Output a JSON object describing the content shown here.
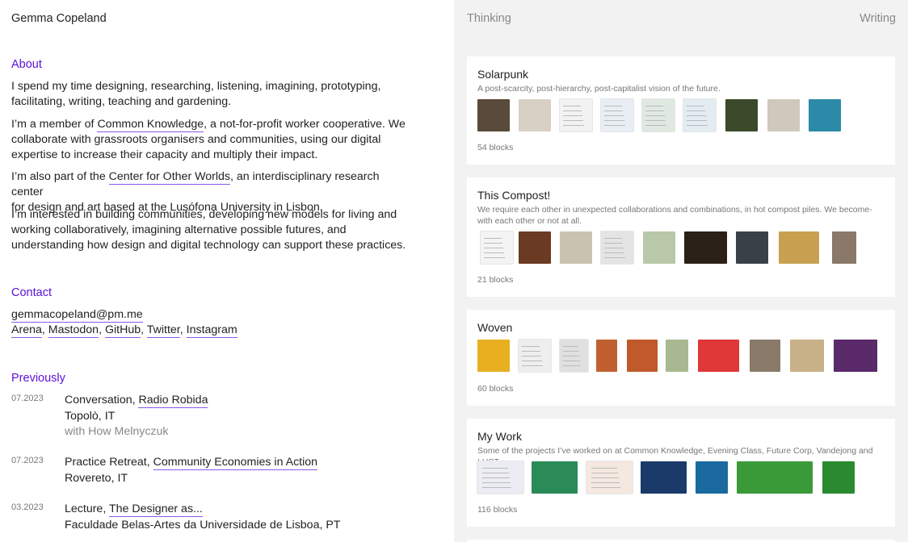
{
  "site": {
    "name": "Gemma Copeland"
  },
  "nav": {
    "thinking": "Thinking",
    "writing": "Writing"
  },
  "about": {
    "heading": "About",
    "p1_line1": "I spend my time designing, researching, listening, imagining, prototyping,",
    "p1_line2": "facilitating, writing, teaching and gardening.",
    "p2_pre": "I’m a member of ",
    "p2_link": "Common Knowledge",
    "p2_post_line1": ", a not-for-profit worker cooperative. We",
    "p2_line2": "collaborate with grassroots organisers and communities, using our digital",
    "p2_line3": "expertise to increase their capacity and multiply their impact.",
    "p3_pre": "I’m also part of the ",
    "p3_link": "Center for Other Worlds",
    "p3_post_line1": ", an interdisciplinary research center",
    "p3_line2": "for design and art based at the Lusófona University in Lisbon.",
    "p4_line1": "I’m interested in building communities, developing new models for living and",
    "p4_line2": "working collaboratively, imagining alternative possible futures, and",
    "p4_line3": "understanding how design and digital technology can support these practices."
  },
  "contact": {
    "heading": "Contact",
    "email": "gemmacopeland@pm.me",
    "links": [
      "Arena",
      "Mastodon",
      "GitHub",
      "Twitter",
      "Instagram"
    ],
    "sep": ", "
  },
  "previously": {
    "heading": "Previously",
    "items": [
      {
        "date": "07.2023",
        "type": "Conversation, ",
        "link": "Radio Robida",
        "place": "Topolò, IT",
        "note": "with How Melnyczuk"
      },
      {
        "date": "07.2023",
        "type": "Practice Retreat, ",
        "link": "Community Economies in Action",
        "place": "Rovereto, IT"
      },
      {
        "date": "03.2023",
        "type": "Lecture, ",
        "link": "The Designer as...",
        "place": "Faculdade Belas-Artes da Universidade de Lisboa, PT"
      }
    ]
  },
  "channels": [
    {
      "title": "Solarpunk",
      "description": "A post-scarcity, post-hierarchy, post-capitalist vision of the future.",
      "count": "54 blocks",
      "thumb_colors": [
        "#5a4a3a",
        "#d8d0c4",
        "#f2f2f2",
        "#e8eef4",
        "#dfe9e2",
        "#e2ecf2",
        "#3a4a2a",
        "#cfc8bc",
        "#2a8aa8"
      ]
    },
    {
      "title": "This Compost!",
      "description": "We require each other in unexpected collaborations and combinations, in hot compost piles. We become-with each other or not at all.",
      "count": "21 blocks",
      "thumb_colors": [
        "#f4f4f4",
        "#6a3a22",
        "#c9c2b0",
        "#e4e4e4",
        "#b8c8a8",
        "#2a2018",
        "#3a4048",
        "#c8a050",
        "#8a7868"
      ]
    },
    {
      "title": "Woven",
      "description": "",
      "count": "60 blocks",
      "thumb_colors": [
        "#e8b020",
        "#eeeeee",
        "#e0e0e0",
        "#c06030",
        "#c05a2a",
        "#a8b890",
        "#e03838",
        "#8a7a6a",
        "#c8b088",
        "#5a2a6a"
      ]
    },
    {
      "title": "My Work",
      "description": "Some of the projects I’ve worked on at Common Knowledge, Evening Class, Future Corp, Vandejong and LUST",
      "count": "116 blocks",
      "thumb_colors": [
        "#ececf4",
        "#2a8a58",
        "#f4e8e0",
        "#1a3a6a",
        "#1a6aa0",
        "#3a9a38",
        "#2a8a30"
      ]
    }
  ]
}
